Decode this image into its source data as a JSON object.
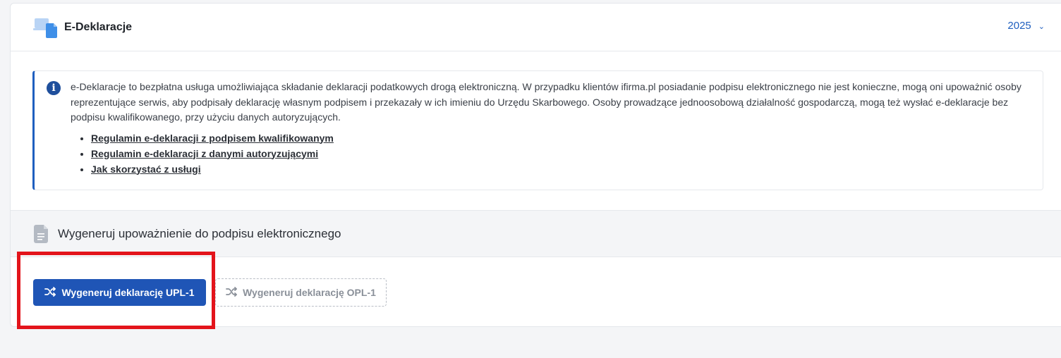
{
  "header": {
    "title": "E-Deklaracje",
    "year": "2025",
    "icon": "devices-icon",
    "chevron": "⌄"
  },
  "info": {
    "icon": "info-icon",
    "text": "e-Deklaracje to bezpłatna usługa umożliwiająca składanie deklaracji podatkowych drogą elektroniczną. W przypadku klientów ifirma.pl posiadanie podpisu elektronicznego nie jest konieczne, mogą oni upoważnić osoby reprezentujące serwis, aby podpisały deklarację własnym podpisem i przekazały w ich imieniu do Urzędu Skarbowego. Osoby prowadzące jednoosobową działalność gospodarczą, mogą też wysłać e-deklaracje bez podpisu kwalifikowanego, przy użyciu danych autoryzujących.",
    "links": [
      "Regulamin e-deklaracji z podpisem kwalifikowanym",
      "Regulamin e-deklaracji z danymi autoryzującymi",
      "Jak skorzystać z usługi"
    ]
  },
  "section": {
    "title": "Wygeneruj upoważnienie do podpisu elektronicznego",
    "icon": "document-icon"
  },
  "buttons": {
    "primary": "Wygeneruj deklarację UPL-1",
    "secondary": "Wygeneruj deklarację OPL-1",
    "icon": "shuffle-icon"
  },
  "colors": {
    "accent": "#1f55b6",
    "highlight": "#e3141b"
  }
}
